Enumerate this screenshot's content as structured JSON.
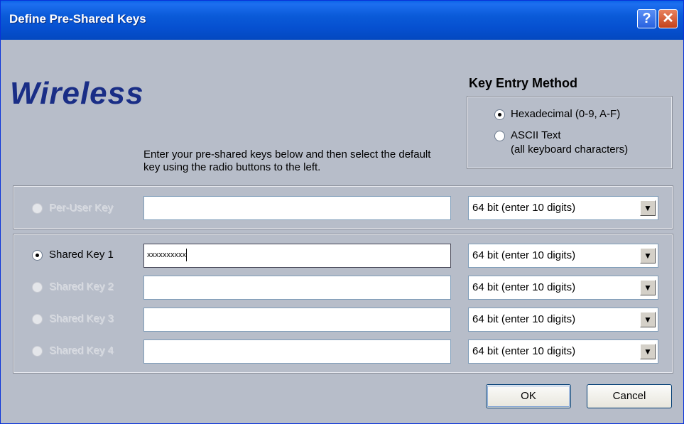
{
  "window": {
    "title": "Define Pre-Shared Keys",
    "help_glyph": "?",
    "close_glyph": "✕"
  },
  "brand": {
    "text": "Wireless"
  },
  "key_entry": {
    "title": "Key Entry Method",
    "options": [
      {
        "label": "Hexadecimal (0-9, A-F)",
        "selected": true
      },
      {
        "label": "ASCII Text",
        "sublabel": "(all keyboard characters)",
        "selected": false
      }
    ]
  },
  "instructions": "Enter your pre-shared keys below and then select the default key using the radio buttons to the left.",
  "per_user": {
    "label": "Per-User Key",
    "value": "",
    "bits": "64 bit (enter 10 digits)",
    "enabled": false
  },
  "shared_keys": [
    {
      "label": "Shared Key 1",
      "value": "xxxxxxxxxx",
      "bits": "64 bit (enter 10 digits)",
      "enabled": true,
      "selected": true
    },
    {
      "label": "Shared Key 2",
      "value": "",
      "bits": "64 bit (enter 10 digits)",
      "enabled": false,
      "selected": false
    },
    {
      "label": "Shared Key 3",
      "value": "",
      "bits": "64 bit (enter 10 digits)",
      "enabled": false,
      "selected": false
    },
    {
      "label": "Shared Key 4",
      "value": "",
      "bits": "64 bit (enter 10 digits)",
      "enabled": false,
      "selected": false
    }
  ],
  "buttons": {
    "ok": "OK",
    "cancel": "Cancel"
  },
  "colors": {
    "brand": "#1a2e86",
    "titlebar": "#0a5ad8",
    "dialog_bg": "#b7bdc9"
  },
  "icons": {
    "dropdown": "▼"
  }
}
